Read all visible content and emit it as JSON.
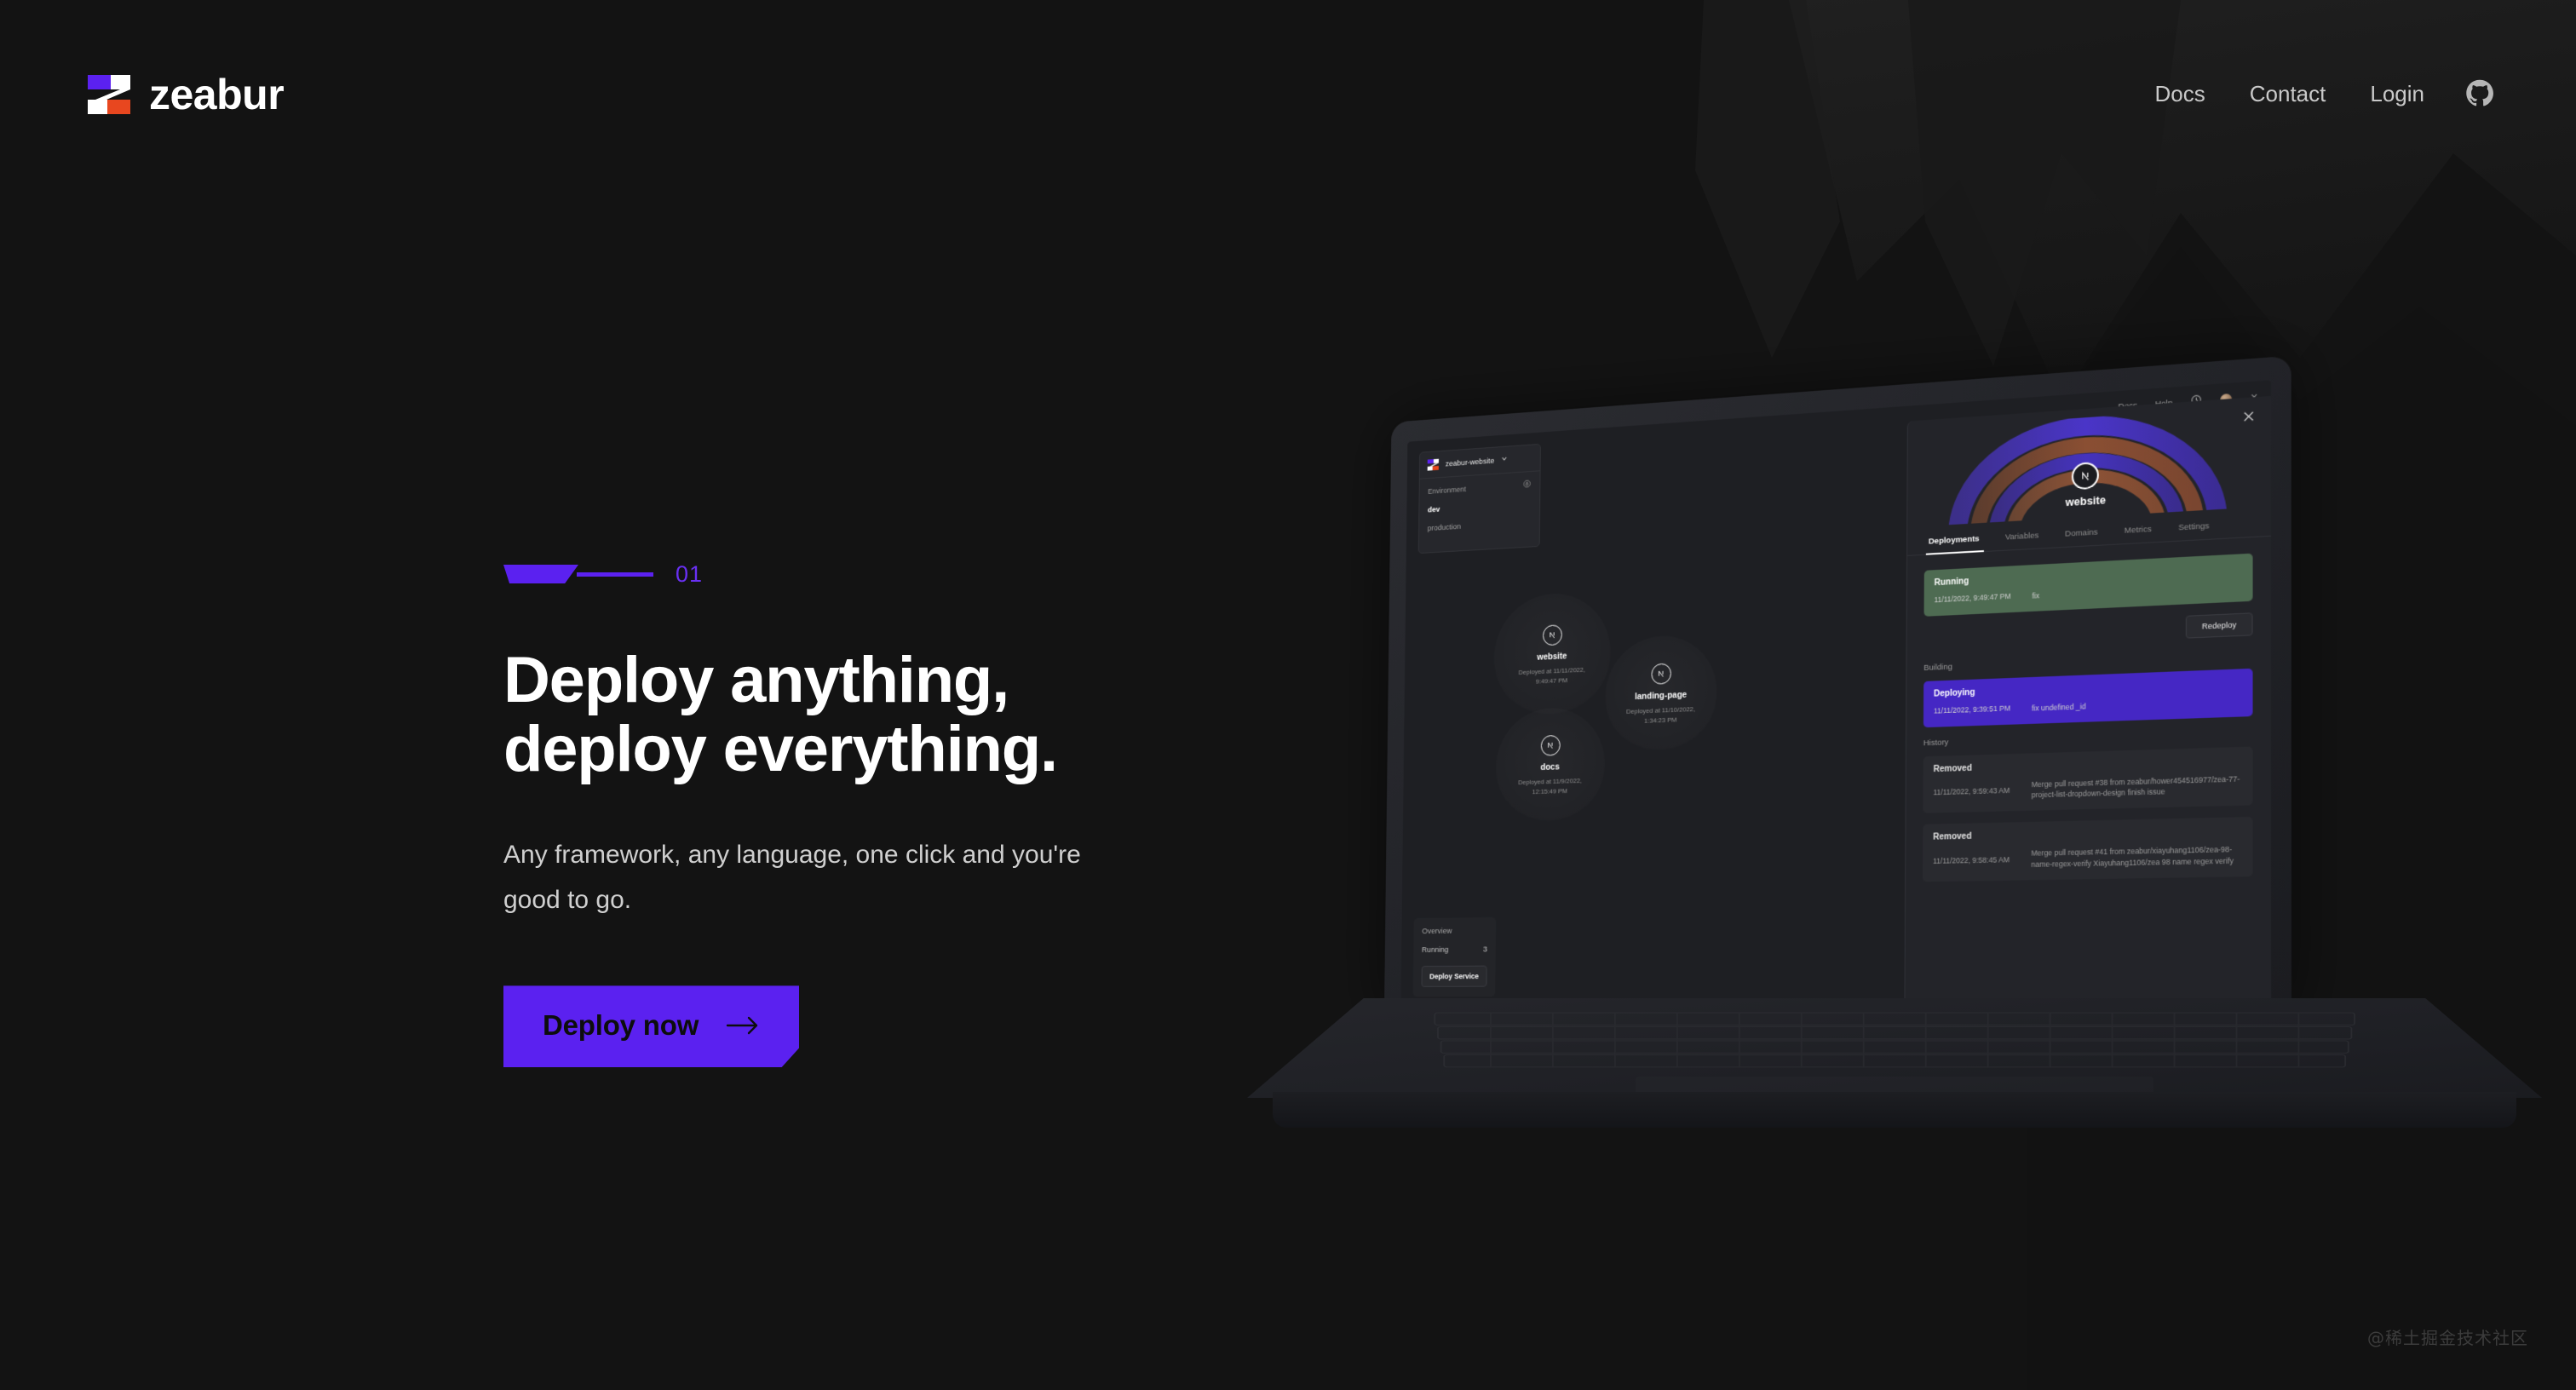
{
  "brand": {
    "name": "zeabur",
    "logo_colors": {
      "purple": "#5B21F0",
      "orange": "#E8471F",
      "white": "#FFFFFF"
    }
  },
  "nav": {
    "items": [
      {
        "label": "Docs",
        "name": "nav-docs"
      },
      {
        "label": "Contact",
        "name": "nav-contact"
      },
      {
        "label": "Login",
        "name": "nav-login"
      }
    ],
    "github_icon": "github-icon"
  },
  "hero": {
    "section_number": "01",
    "headline_line1": "Deploy anything,",
    "headline_line2": "deploy everything.",
    "subline_line1": "Any framework, any language, one click and",
    "subline_line2": "you're good to go.",
    "cta_label": "Deploy now",
    "cta_icon": "arrow-right-icon",
    "accent": "#5B21F0"
  },
  "mockup": {
    "app_header": {
      "docs": "Docs",
      "help": "Help",
      "history_icon": "clock-icon",
      "chevron": "chevron-down-icon"
    },
    "project": {
      "name": "zeabur-website",
      "chevron": "chevron-down-icon",
      "environment_label": "Environment",
      "lock_icon": "lock-icon",
      "environments": [
        {
          "label": "dev",
          "selected": true
        },
        {
          "label": "production",
          "selected": false
        }
      ]
    },
    "services": [
      {
        "name": "website",
        "deployed": "Deployed at 11/11/2022,",
        "deployed2": "9:49:47 PM",
        "icon": "nextjs-icon"
      },
      {
        "name": "landing-page",
        "deployed": "Deployed at 11/10/2022,",
        "deployed2": "1:34:23 PM",
        "icon": "nextjs-icon"
      },
      {
        "name": "docs",
        "deployed": "Deployed at 11/9/2022,",
        "deployed2": "12:15:49 PM",
        "icon": "nextjs-icon"
      }
    ],
    "overview": {
      "title": "Overview",
      "running_label": "Running",
      "running_count": "3",
      "deploy_button": "Deploy Service"
    },
    "detail": {
      "title": "website",
      "close_icon": "close-icon",
      "tabs": [
        {
          "label": "Deployments",
          "active": true
        },
        {
          "label": "Variables",
          "active": false
        },
        {
          "label": "Domains",
          "active": false
        },
        {
          "label": "Metrics",
          "active": false
        },
        {
          "label": "Settings",
          "active": false
        }
      ],
      "running": {
        "status": "Running",
        "time": "11/11/2022, 9:49:47 PM",
        "message": "fix"
      },
      "redeploy_label": "Redeploy",
      "building_label": "Building",
      "deploying": {
        "status": "Deploying",
        "time": "11/11/2022, 9:39:51 PM",
        "message": "fix undefined _id"
      },
      "history_label": "History",
      "history": [
        {
          "status": "Removed",
          "time": "11/11/2022, 9:59:43 AM",
          "message": "Merge pull request #38 from zeabur/hower454516977/zea-77-project-list-dropdown-design finish issue"
        },
        {
          "status": "Removed",
          "time": "11/11/2022, 9:58:45 AM",
          "message": "Merge pull request #41 from zeabur/xiayuhang1106/zea-98-name-regex-verify Xiayuhang1106/zea 98 name regex verify"
        }
      ]
    }
  },
  "watermark": "@稀土掘金技术社区"
}
